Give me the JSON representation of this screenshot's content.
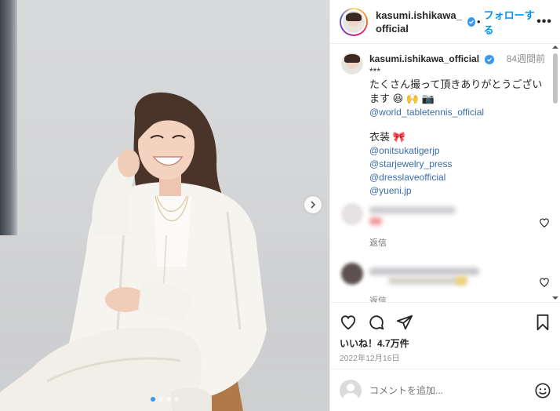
{
  "post": {
    "username": "kasumi.ishikawa_official",
    "follow_label": "フォローする",
    "more_label": "•••",
    "dot_separator": "•",
    "verified_icon": "verified-badge-icon"
  },
  "caption": {
    "username": "kasumi.ishikawa_official",
    "time_ago": "84週間前",
    "stars": "***",
    "line1": "たくさん撮って頂きありがとうござい",
    "line2": "ます 😆 🙌 📷",
    "mention_main": "@world_tabletennis_official",
    "costume_label": "衣装 🎀",
    "mentions": [
      "@onitsukatigerjp",
      "@starjewelry_press",
      "@dresslaveofficial",
      "@yueni.jp"
    ]
  },
  "comments": [
    {
      "reply_label": "返信"
    },
    {
      "reply_label": "返信"
    }
  ],
  "engagement": {
    "likes": "いいね！4.7万件",
    "date": "2022年12月16日"
  },
  "comment_box": {
    "placeholder": "コメントを追加..."
  },
  "carousel": {
    "dots": 4,
    "active_index": 0
  },
  "colors": {
    "accent": "#0095f6",
    "link": "#3b6ea8",
    "muted": "#8e8e8e"
  }
}
